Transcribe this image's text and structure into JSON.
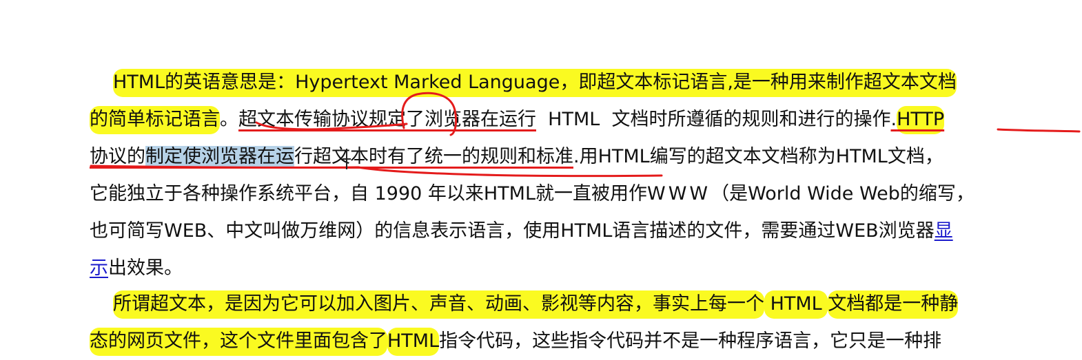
{
  "document": {
    "paragraph1": {
      "line1": {
        "a": "HTML的英语意思是：Hypertext Marked Language，即超文本标记语言,是一种用来制作超文本文档"
      },
      "line2": {
        "a": "的简单标记语言",
        "b": "。",
        "c": "超文本传输协议规定了浏览器在运行",
        "d": "  HTML  ",
        "e": "文档时所遵循的规则和进行的操作",
        "f": ".",
        "g": "HTTP"
      },
      "line3": {
        "a": "协议的",
        "b": "制定使浏览器在运",
        "c": "行",
        "d": "超文本时有了统一的规则和标准",
        "e": ".用HTML编写的超文本文档称为HTML文档，"
      },
      "line4": {
        "a": "它能独立于各种操作系统平台，自 1990 年以来HTML就一直被用作",
        "b": "WWW",
        "c": "（是World Wide Web的缩写，"
      },
      "line5": {
        "a": "也可简写WEB、中文叫做万维网）的信息表示语言，使用HTML语言描述的文件，需要通过WEB浏览器",
        "b": "显"
      },
      "line6": {
        "a": "示",
        "b": "出效果。"
      }
    },
    "paragraph2": {
      "line1": {
        "a": "所谓超文本，是因为它可以加入图片、声音、动画、影视等内容，事实上每一个",
        "b": " HTML ",
        "c": "文档都是一种静"
      },
      "line2": {
        "a": "态的网页文件，这个文件里面包含了",
        "b": "HTML",
        "c": "指令代码，这些指令代码并不是一种程序语言，它只是一种排"
      }
    }
  },
  "colors": {
    "highlight": "#fafa21",
    "ink": "#e41b1b",
    "selection": "#b6d2e8",
    "link": "#1a1acc"
  },
  "cursor": {
    "icon": "text-ibeam-cursor"
  }
}
